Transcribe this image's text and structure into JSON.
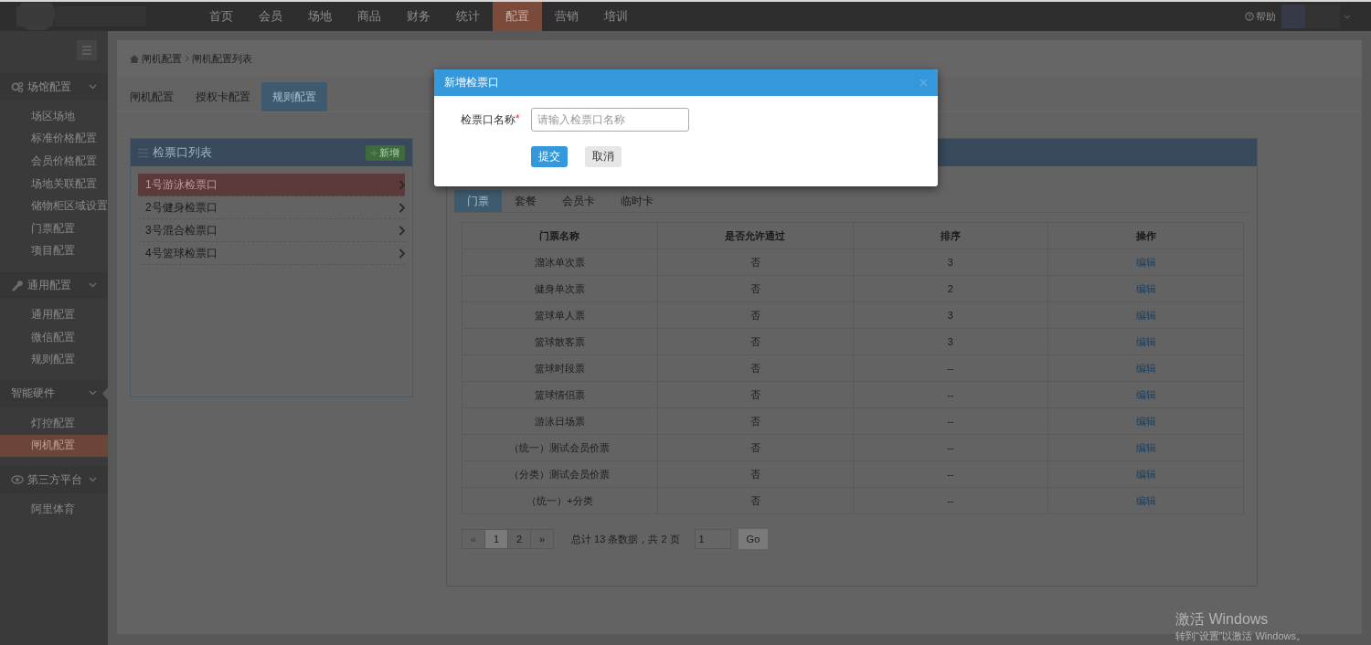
{
  "top_nav": {
    "items": [
      {
        "label": "首页",
        "selected": false
      },
      {
        "label": "会员",
        "selected": false
      },
      {
        "label": "场地",
        "selected": false
      },
      {
        "label": "商品",
        "selected": false
      },
      {
        "label": "财务",
        "selected": false
      },
      {
        "label": "统计",
        "selected": false
      },
      {
        "label": "配置",
        "selected": true
      },
      {
        "label": "营销",
        "selected": false
      },
      {
        "label": "培训",
        "selected": false
      }
    ],
    "help": "帮助"
  },
  "sidebar": {
    "groups": [
      {
        "label": "场馆配置",
        "expanded": true,
        "items": [
          {
            "label": "场区场地",
            "selected": false
          },
          {
            "label": "标准价格配置",
            "selected": false
          },
          {
            "label": "会员价格配置",
            "selected": false
          },
          {
            "label": "场地关联配置",
            "selected": false
          },
          {
            "label": "储物柜区域设置",
            "selected": false
          },
          {
            "label": "门票配置",
            "selected": false
          },
          {
            "label": "项目配置",
            "selected": false
          }
        ]
      },
      {
        "label": "通用配置",
        "expanded": true,
        "items": [
          {
            "label": "通用配置",
            "selected": false
          },
          {
            "label": "微信配置",
            "selected": false
          },
          {
            "label": "规则配置",
            "selected": false
          }
        ]
      },
      {
        "label": "智能硬件",
        "expanded": true,
        "items": [
          {
            "label": "灯控配置",
            "selected": false
          },
          {
            "label": "闸机配置",
            "selected": true
          }
        ]
      },
      {
        "label": "第三方平台",
        "expanded": true,
        "items": [
          {
            "label": "阿里体育",
            "selected": false
          }
        ]
      }
    ]
  },
  "breadcrumb": [
    "闸机配置",
    "闸机配置列表"
  ],
  "tabs": [
    {
      "label": "闸机配置",
      "selected": false
    },
    {
      "label": "授权卡配置",
      "selected": false
    },
    {
      "label": "规则配置",
      "selected": true
    }
  ],
  "gate_panel": {
    "title": "检票口列表",
    "add_button": "新增",
    "items": [
      {
        "label": "1号游泳检票口",
        "selected": true
      },
      {
        "label": "2号健身检票口",
        "selected": false
      },
      {
        "label": "3号混合检票口",
        "selected": false
      },
      {
        "label": "4号篮球检票口",
        "selected": false
      }
    ]
  },
  "ticket_panel": {
    "tabs": [
      {
        "label": "门票",
        "selected": true
      },
      {
        "label": "套餐",
        "selected": false
      },
      {
        "label": "会员卡",
        "selected": false
      },
      {
        "label": "临时卡",
        "selected": false
      }
    ],
    "table": {
      "columns": [
        "门票名称",
        "是否允许通过",
        "排序",
        "操作"
      ],
      "rows": [
        [
          "溜冰单次票",
          "否",
          "3",
          "编辑"
        ],
        [
          "健身单次票",
          "否",
          "2",
          "编辑"
        ],
        [
          "篮球单人票",
          "否",
          "3",
          "编辑"
        ],
        [
          "篮球散客票",
          "否",
          "3",
          "编辑"
        ],
        [
          "篮球时段票",
          "否",
          "--",
          "编辑"
        ],
        [
          "篮球情侣票",
          "否",
          "--",
          "编辑"
        ],
        [
          "游泳日场票",
          "否",
          "--",
          "编辑"
        ],
        [
          "（统一）测试会员价票",
          "否",
          "--",
          "编辑"
        ],
        [
          "（分类）测试会员价票",
          "否",
          "--",
          "编辑"
        ],
        [
          "（统一）+分类",
          "否",
          "--",
          "编辑"
        ]
      ]
    },
    "pagination": {
      "prev": "«",
      "pages": [
        {
          "label": "1",
          "selected": true
        },
        {
          "label": "2",
          "selected": false
        }
      ],
      "next": "»",
      "summary": "总计 13 条数据，共 2 页",
      "jump_value": "1",
      "go": "Go"
    }
  },
  "dialog": {
    "title": "新增检票口",
    "field_label": "检票口名称",
    "required_mark": "*",
    "placeholder": "请输入检票口名称",
    "submit": "提交",
    "cancel": "取消"
  },
  "os_notice": {
    "title": "激活 Windows",
    "text": "转到“设置”以激活 Windows。"
  }
}
